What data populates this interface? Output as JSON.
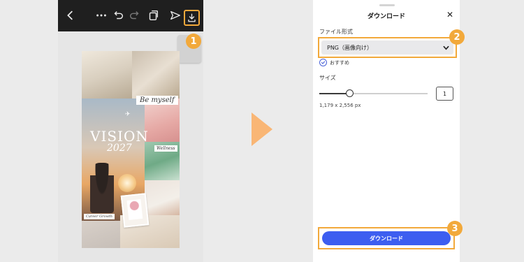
{
  "left_screen": {
    "toolbar": {
      "back_icon": "chevron-left-icon",
      "more_icon": "more-horizontal-icon",
      "undo_icon": "undo-icon",
      "redo_icon": "redo-icon",
      "pages_icon": "pages-icon",
      "share_icon": "send-icon",
      "download_icon": "download-icon"
    },
    "design": {
      "vision_text": "VISION",
      "year_text": "2027",
      "be_myself": "Be myself",
      "wellness": "Wellness",
      "career": "Career Growth"
    }
  },
  "right_screen": {
    "title": "ダウンロード",
    "file_format_label": "ファイル形式",
    "file_format_value": "PNG（画像向け）",
    "recommended_label": "おすすめ",
    "size_label": "サイズ",
    "size_value": "1",
    "size_slider_fraction": 0.28,
    "pixel_dimensions": "1,179 x 2,556 px",
    "download_button": "ダウンロード"
  },
  "badges": {
    "step1": "1",
    "step2": "2",
    "step3": "3"
  },
  "colors": {
    "highlight": "#f2a93b",
    "arrow": "#f9b675",
    "button_blue": "#3d5ef0",
    "toolbar_dark": "#1f1f1f"
  }
}
